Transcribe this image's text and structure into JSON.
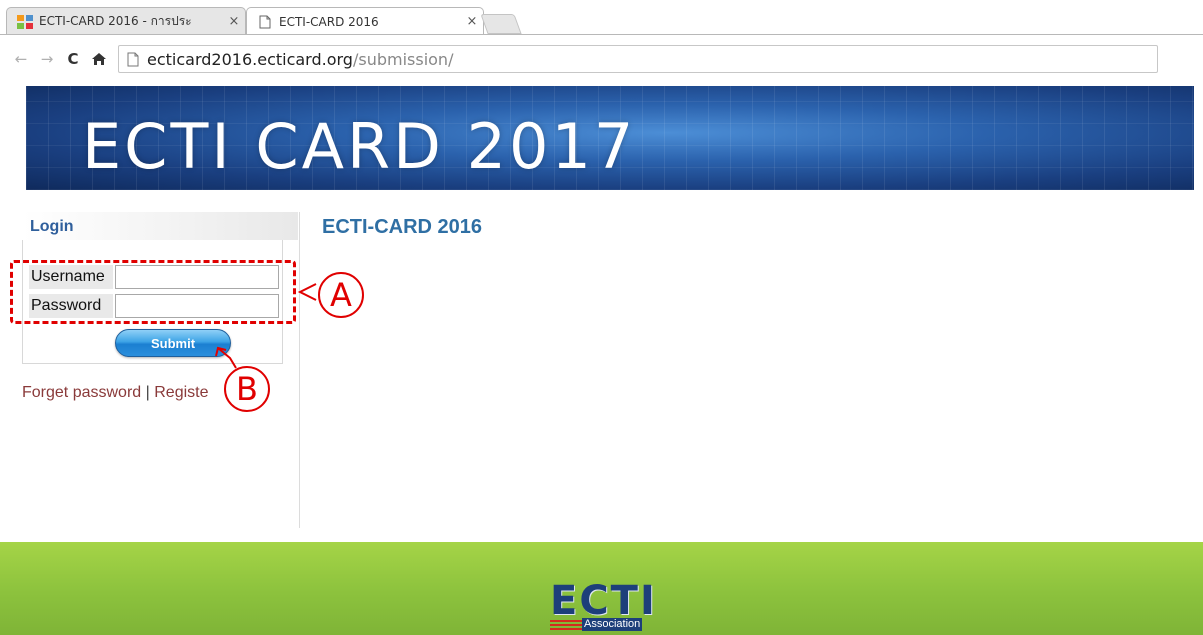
{
  "browser": {
    "tabs": [
      {
        "title": "ECTI-CARD 2016 - การประ",
        "active": false
      },
      {
        "title": "ECTI-CARD 2016",
        "active": true
      }
    ],
    "close_glyph": "×",
    "url_host": "ecticard2016.ecticard.org",
    "url_path": "/submission/",
    "nav_icons": [
      "back-arrow-icon",
      "forward-arrow-icon",
      "reload-icon",
      "home-icon"
    ]
  },
  "banner": {
    "title": "ECTI CARD 2017"
  },
  "sidebar": {
    "login_heading": "Login",
    "username_label": "Username",
    "password_label": "Password",
    "username_value": "",
    "password_value": "",
    "submit_label": "Submit",
    "forget_password": "Forget password",
    "separator": "|",
    "register": "Registe"
  },
  "annotations": {
    "a": "A",
    "b": "B",
    "color": "#e00000"
  },
  "main": {
    "title": "ECTI-CARD 2016"
  },
  "footer": {
    "logo_text": "ECTI",
    "logo_sub": "Association"
  },
  "colors": {
    "heading_blue": "#2f6fa4",
    "link_red": "#8a3a3a",
    "footer_green": "#8cc23d",
    "banner_blue": "#2b62ad"
  }
}
